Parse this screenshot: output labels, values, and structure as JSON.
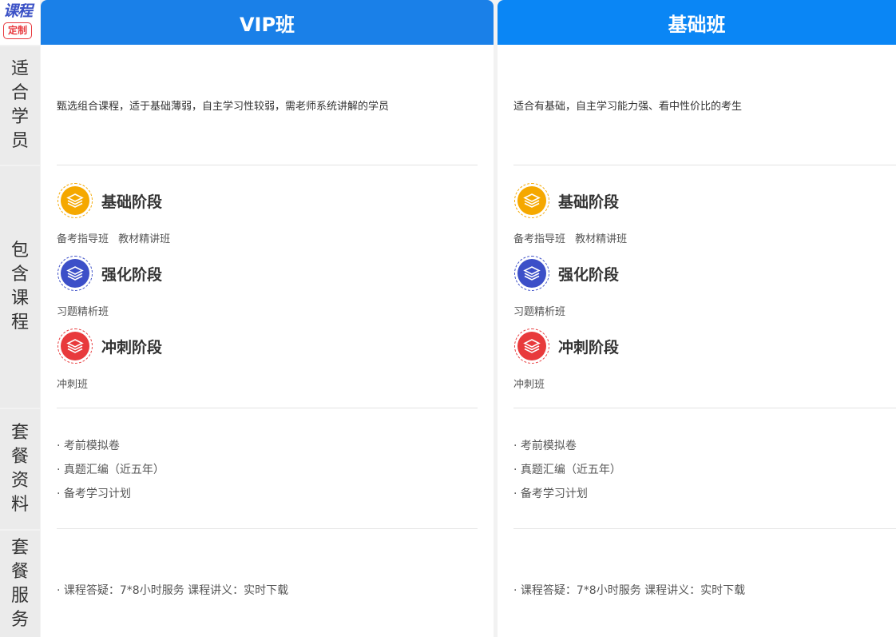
{
  "logo": {
    "top_text": "课程",
    "stamp_text": "定制"
  },
  "row_labels": [
    "适合学员",
    "包含课程",
    "套餐资料",
    "套餐服务"
  ],
  "colors": {
    "vip_header": "#1a80e8",
    "basic_header": "#0a86f5",
    "stage1": "#f5a800",
    "stage2": "#3c4fc8",
    "stage3": "#e83a3c"
  },
  "icons": {
    "stage": "layers-icon"
  },
  "columns": [
    {
      "title": "VIP班",
      "suitable": "甄选组合课程，适于基础薄弱，自主学习性较弱，需老师系统讲解的学员",
      "stages": [
        {
          "name": "基础阶段",
          "courses": "备考指导班 教材精讲班"
        },
        {
          "name": "强化阶段",
          "courses": "习题精析班"
        },
        {
          "name": "冲刺阶段",
          "courses": "冲刺班"
        }
      ],
      "materials": [
        "· 考前模拟卷",
        "· 真题汇编（近五年）",
        "· 备考学习计划"
      ],
      "service": "· 课程答疑：7*8小时服务 课程讲义：实时下载"
    },
    {
      "title": "基础班",
      "suitable": "适合有基础，自主学习能力强、看中性价比的考生",
      "stages": [
        {
          "name": "基础阶段",
          "courses": "备考指导班 教材精讲班"
        },
        {
          "name": "强化阶段",
          "courses": "习题精析班"
        },
        {
          "name": "冲刺阶段",
          "courses": "冲刺班"
        }
      ],
      "materials": [
        "· 考前模拟卷",
        "· 真题汇编（近五年）",
        "· 备考学习计划"
      ],
      "service": "· 课程答疑：7*8小时服务 课程讲义：实时下载"
    }
  ]
}
